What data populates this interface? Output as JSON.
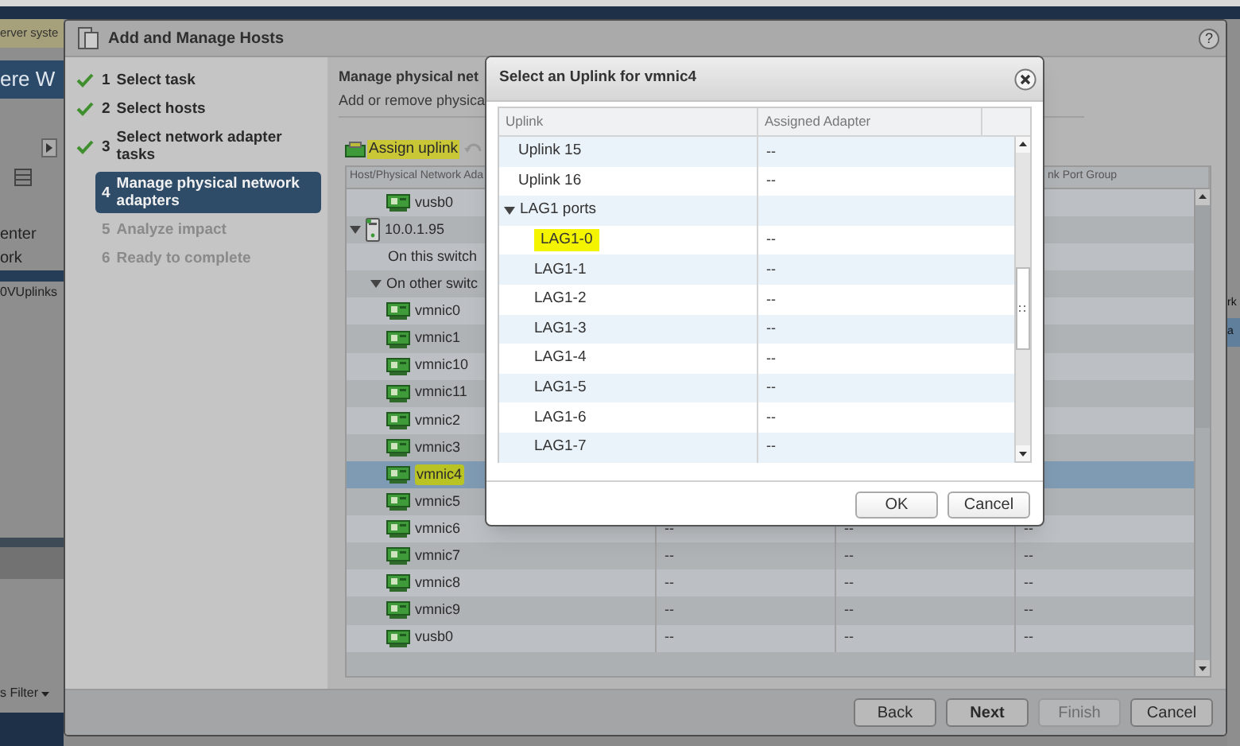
{
  "background": {
    "banner": "erver syste",
    "header": "ere W",
    "nav_items": [
      "enter",
      "ork",
      "0VUplinks"
    ],
    "right_fragments": [
      "rk",
      "a"
    ],
    "filter": "s Filter"
  },
  "wizard": {
    "title": "Add and Manage Hosts",
    "help": "?",
    "steps": [
      {
        "number": "1",
        "label": "Select task",
        "completed": true,
        "selected": false
      },
      {
        "number": "2",
        "label": "Select hosts",
        "completed": true,
        "selected": false
      },
      {
        "number": "3",
        "label": "Select network adapter tasks",
        "completed": true,
        "selected": false
      },
      {
        "number": "4",
        "label": "Manage physical network adapters",
        "completed": false,
        "selected": true
      },
      {
        "number": "5",
        "label": "Analyze impact",
        "completed": false,
        "selected": false
      },
      {
        "number": "6",
        "label": "Ready to complete",
        "completed": false,
        "selected": false
      }
    ],
    "heading": "Manage physical net",
    "subheading": "Add or remove physica",
    "toolbar": {
      "assign_uplink": {
        "label": "Assign uplink",
        "highlighted": true
      }
    },
    "table": {
      "columns": [
        "Host/Physical Network Ada",
        "",
        "",
        "nk Port Group"
      ],
      "rows": [
        {
          "kind": "adapter",
          "label": "vusb0",
          "selected": false,
          "highlighted": false
        },
        {
          "kind": "host",
          "label": "10.0.1.95",
          "expanded": true,
          "selected": false,
          "highlighted": false,
          "children": [
            {
              "kind": "group",
              "label": "On this switch",
              "selected": false,
              "highlighted": false
            },
            {
              "kind": "group",
              "label": "On other switc",
              "expanded": true,
              "selected": false,
              "highlighted": false,
              "children": [
                {
                  "kind": "adapter",
                  "label": "vmnic0",
                  "selected": false,
                  "highlighted": false
                },
                {
                  "kind": "adapter",
                  "label": "vmnic1",
                  "selected": false,
                  "highlighted": false
                },
                {
                  "kind": "adapter",
                  "label": "vmnic10",
                  "selected": false,
                  "highlighted": false
                },
                {
                  "kind": "adapter",
                  "label": "vmnic11",
                  "selected": false,
                  "highlighted": false
                },
                {
                  "kind": "adapter",
                  "label": "vmnic2",
                  "selected": false,
                  "highlighted": false
                },
                {
                  "kind": "adapter",
                  "label": "vmnic3",
                  "selected": false,
                  "highlighted": false
                },
                {
                  "kind": "adapter",
                  "label": "vmnic4",
                  "selected": true,
                  "highlighted": true
                },
                {
                  "kind": "adapter",
                  "label": "vmnic5",
                  "selected": false,
                  "highlighted": false
                },
                {
                  "kind": "adapter",
                  "label": "vmnic6",
                  "selected": false,
                  "highlighted": false,
                  "cells": [
                    "--",
                    "--",
                    "--"
                  ]
                },
                {
                  "kind": "adapter",
                  "label": "vmnic7",
                  "selected": false,
                  "highlighted": false,
                  "cells": [
                    "--",
                    "--",
                    "--"
                  ]
                },
                {
                  "kind": "adapter",
                  "label": "vmnic8",
                  "selected": false,
                  "highlighted": false,
                  "cells": [
                    "--",
                    "--",
                    "--"
                  ]
                },
                {
                  "kind": "adapter",
                  "label": "vmnic9",
                  "selected": false,
                  "highlighted": false,
                  "cells": [
                    "--",
                    "--",
                    "--"
                  ]
                },
                {
                  "kind": "adapter",
                  "label": "vusb0",
                  "selected": false,
                  "highlighted": false,
                  "cells": [
                    "--",
                    "--",
                    "--"
                  ]
                }
              ]
            }
          ]
        }
      ]
    },
    "buttons": [
      {
        "label": "Back",
        "default": false,
        "disabled": false
      },
      {
        "label": "Next",
        "default": true,
        "disabled": false
      },
      {
        "label": "Finish",
        "default": false,
        "disabled": true
      },
      {
        "label": "Cancel",
        "default": false,
        "disabled": false
      }
    ]
  },
  "dialog": {
    "title": "Select an Uplink for vmnic4",
    "columns": [
      "Uplink",
      "Assigned Adapter"
    ],
    "rows": [
      {
        "label": "Uplink 15",
        "adapter": "--",
        "highlighted": false
      },
      {
        "label": "Uplink 16",
        "adapter": "--",
        "highlighted": false
      },
      {
        "label": "LAG1 ports",
        "expanded": true,
        "highlighted": false,
        "children": [
          {
            "label": "LAG1-0",
            "adapter": "--",
            "highlighted": true
          },
          {
            "label": "LAG1-1",
            "adapter": "--",
            "highlighted": false
          },
          {
            "label": "LAG1-2",
            "adapter": "--",
            "highlighted": false
          },
          {
            "label": "LAG1-3",
            "adapter": "--",
            "highlighted": false
          },
          {
            "label": "LAG1-4",
            "adapter": "--",
            "highlighted": false
          },
          {
            "label": "LAG1-5",
            "adapter": "--",
            "highlighted": false
          },
          {
            "label": "LAG1-6",
            "adapter": "--",
            "highlighted": false
          },
          {
            "label": "LAG1-7",
            "adapter": "--",
            "highlighted": false
          }
        ]
      }
    ],
    "buttons": [
      {
        "label": "OK",
        "default": false
      },
      {
        "label": "Cancel",
        "default": false
      }
    ]
  }
}
